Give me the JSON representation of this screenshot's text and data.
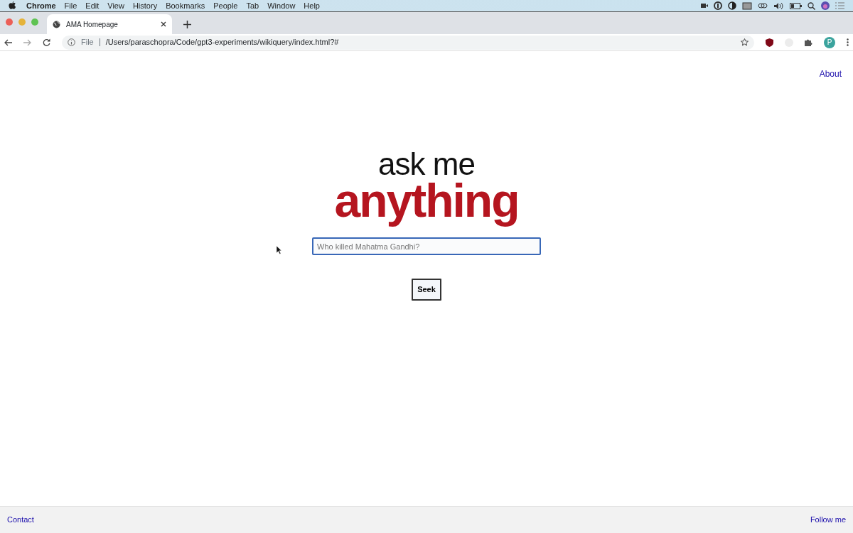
{
  "menu_bar": {
    "app": "Chrome",
    "items": [
      "File",
      "Edit",
      "View",
      "History",
      "Bookmarks",
      "People",
      "Tab",
      "Window",
      "Help"
    ]
  },
  "browser_tab": {
    "title": "AMA Homepage"
  },
  "address_bar": {
    "scheme": "File",
    "url": "/Users/paraschopra/Code/gpt3-experiments/wikiquery/index.html?#"
  },
  "profile": {
    "initial": "P"
  },
  "nav": {
    "link": "About"
  },
  "logo": {
    "line_1": "ask me",
    "line_2": "anything"
  },
  "search": {
    "placeholder": "Who killed Mahatma Gandhi?"
  },
  "button": {
    "label": "Seek"
  },
  "footer": {
    "left": "Contact",
    "right": "Follow me"
  }
}
